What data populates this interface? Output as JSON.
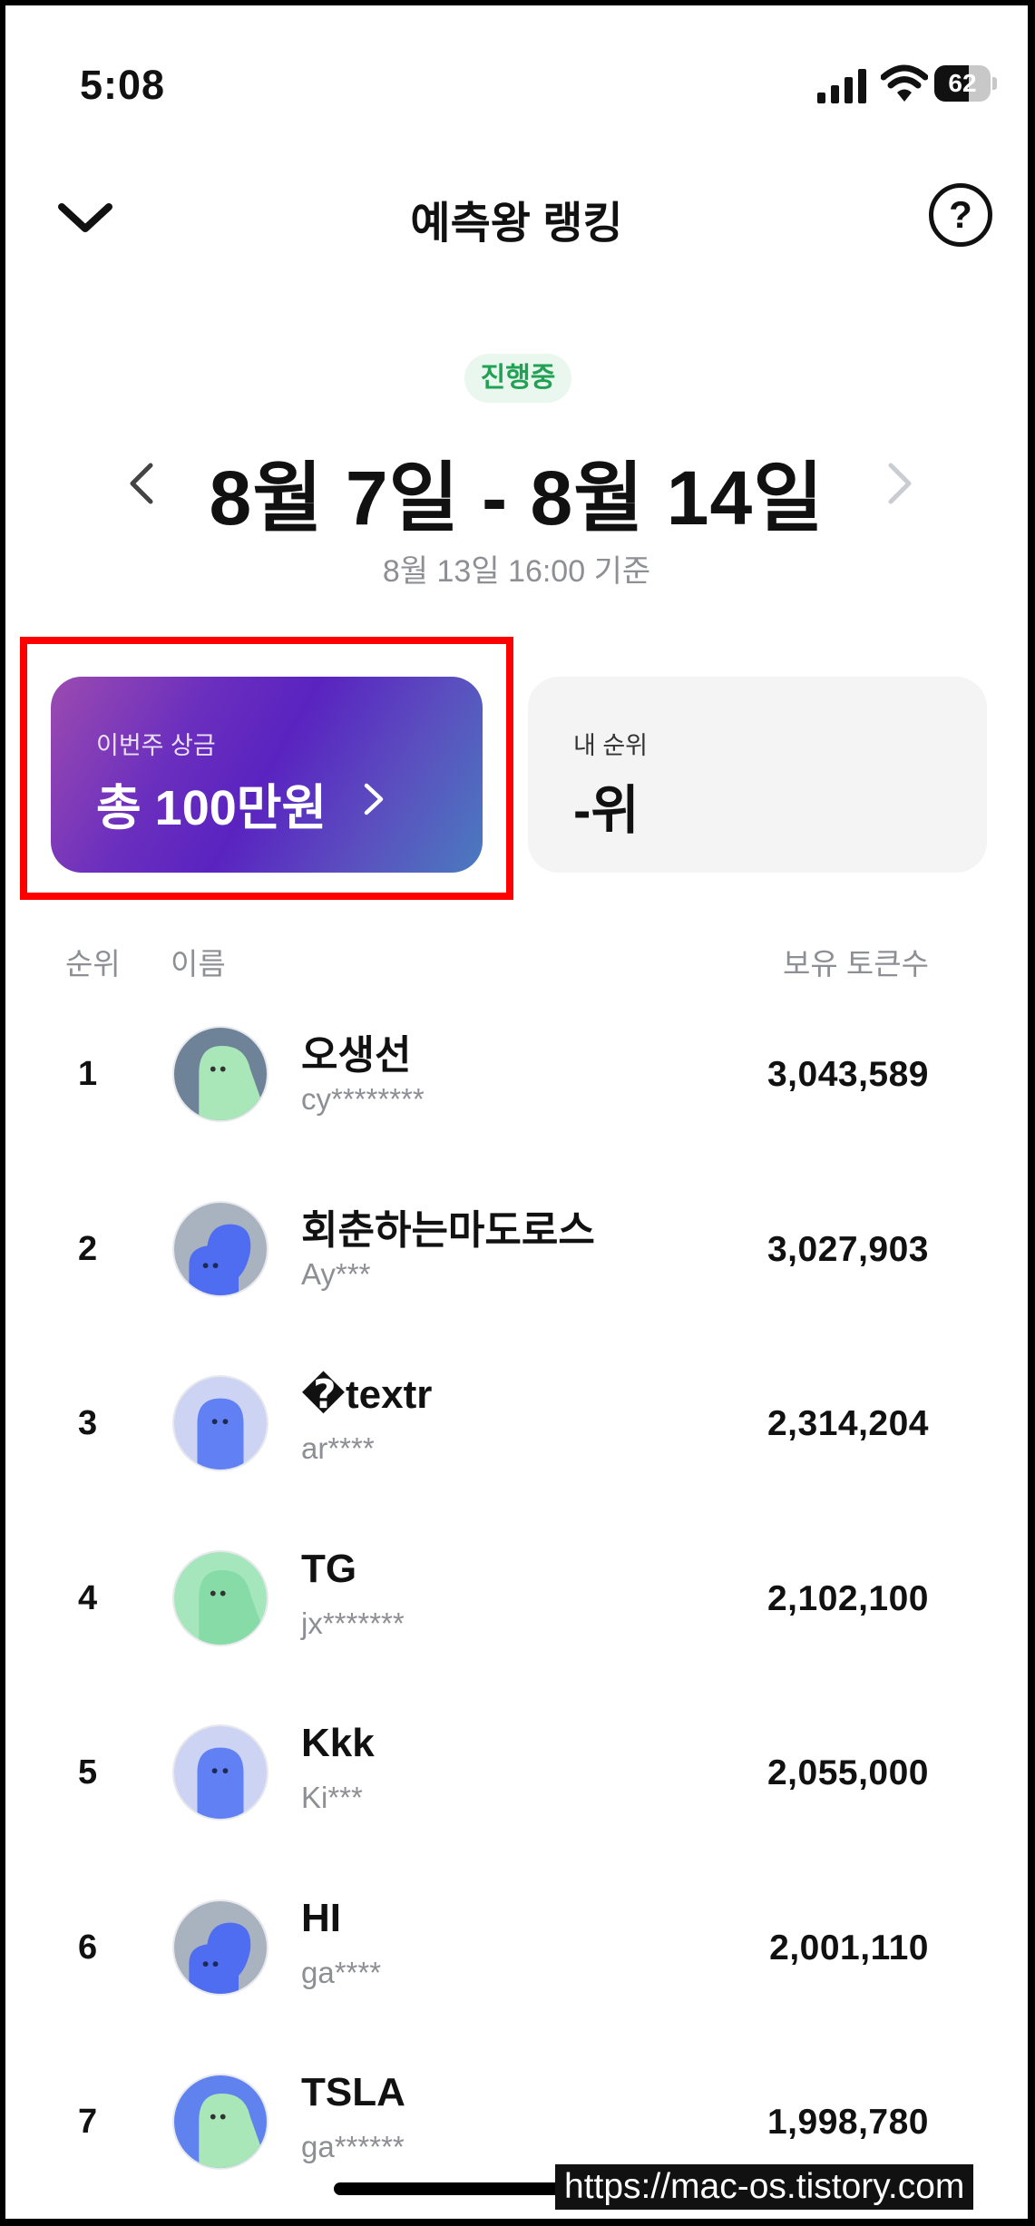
{
  "status_bar": {
    "time": "5:08",
    "battery": "62",
    "battery_level": 0.62
  },
  "header": {
    "title": "예측왕 랭킹",
    "back_icon": "chevron-down-icon",
    "help_label": "?"
  },
  "week": {
    "status_badge": "진행중",
    "range": "8월 7일 - 8월 14일",
    "basis": "8월 13일 16:00 기준"
  },
  "prize_card": {
    "label": "이번주 상금",
    "amount": "총 100만원",
    "chevron_icon": "chevron-right-icon"
  },
  "my_rank": {
    "label": "내 순위",
    "value": "-위"
  },
  "table": {
    "headers": {
      "rank": "순위",
      "name": "이름",
      "tokens": "보유 토큰수"
    },
    "rows": [
      {
        "rank": "1",
        "name": "오생선",
        "id": "cy********",
        "tokens": "3,043,589",
        "avatar": {
          "bg": "#6e8398",
          "body": "#a9e6b8",
          "shape": "tilt"
        }
      },
      {
        "rank": "2",
        "name": "회춘하는마도로스",
        "id": "Ay***",
        "tokens": "3,027,903",
        "avatar": {
          "bg": "#a9b3c0",
          "body": "#4f6df0",
          "shape": "blob"
        }
      },
      {
        "rank": "3",
        "name": "�textr",
        "id": "ar****",
        "tokens": "2,314,204",
        "avatar": {
          "bg": "#ccd3f3",
          "body": "#6080f4",
          "shape": "ghost"
        }
      },
      {
        "rank": "4",
        "name": "TG",
        "id": "jx*******",
        "tokens": "2,102,100",
        "avatar": {
          "bg": "#a6e6bd",
          "body": "#86dba6",
          "shape": "tilt"
        }
      },
      {
        "rank": "5",
        "name": "Kkk",
        "id": "Ki***",
        "tokens": "2,055,000",
        "avatar": {
          "bg": "#ccd3f3",
          "body": "#6080f4",
          "shape": "ghost"
        }
      },
      {
        "rank": "6",
        "name": "HI",
        "id": "ga****",
        "tokens": "2,001,110",
        "avatar": {
          "bg": "#a9b3c0",
          "body": "#4f6df0",
          "shape": "blob"
        }
      },
      {
        "rank": "7",
        "name": "TSLA",
        "id": "ga******",
        "tokens": "1,998,780",
        "avatar": {
          "bg": "#5f82ef",
          "body": "#a9e6b8",
          "shape": "tilt"
        }
      }
    ]
  },
  "watermark": "https://mac-os.tistory.com"
}
